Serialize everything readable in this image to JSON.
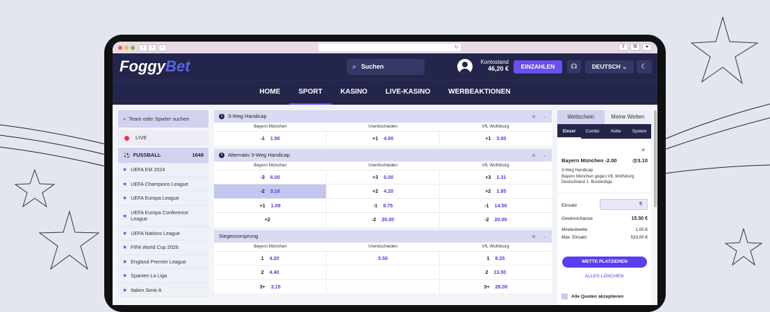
{
  "header": {
    "logo_part1": "Foggy",
    "logo_part2": "Bet",
    "search_label": "Suchen",
    "balance_label": "Kontostand",
    "balance_value": "46,20 €",
    "deposit_button": "EINZAHLEN",
    "language": "DEUTSCH ⌄"
  },
  "nav": {
    "items": [
      "HOME",
      "SPORT",
      "KASINO",
      "LIVE-KASINO",
      "WERBEAKTIONEN"
    ],
    "active": "SPORT"
  },
  "sidebar": {
    "search_placeholder": "Team oder Spieler suchen",
    "live": "LIVE",
    "football": "FUSSBALL",
    "football_count": "1648",
    "leagues": [
      "UEFA EM 2024",
      "UEFA Champions League",
      "UEFA Europa League",
      "UEFA Europa Conference League",
      "UEFA Nations League",
      "FIFA World Cup 2026",
      "England Premier League",
      "Spanien La Liga",
      "Italien Serie A"
    ]
  },
  "markets": {
    "m1": {
      "title": "3-Weg Handicap",
      "cols": [
        "Bayern München",
        "Unentschieden",
        "VfL Wolfsburg"
      ],
      "rows": [
        [
          {
            "h": "-1",
            "o": "1.90"
          },
          {
            "h": "+1",
            "o": "4.00"
          },
          {
            "h": "+1",
            "o": "3.00"
          }
        ]
      ]
    },
    "m2": {
      "title": "Alternativ 3-Weg Handicap",
      "cols": [
        "Bayern München",
        "Unentschieden",
        "VfL Wolfsburg"
      ],
      "rows": [
        [
          {
            "h": "-3",
            "o": "6.00"
          },
          {
            "h": "+3",
            "o": "6.00"
          },
          {
            "h": "+3",
            "o": "1.31"
          }
        ],
        [
          {
            "h": "-2",
            "o": "3.10"
          },
          {
            "h": "+2",
            "o": "4.20"
          },
          {
            "h": "+2",
            "o": "1.85"
          }
        ],
        [
          {
            "h": "+1",
            "o": "1.09"
          },
          {
            "h": "-1",
            "o": "8.75"
          },
          {
            "h": "-1",
            "o": "14.50"
          }
        ],
        [
          {
            "h": "+2",
            "o": ""
          },
          {
            "h": "-2",
            "o": "20.00"
          },
          {
            "h": "-2",
            "o": "20.00"
          }
        ]
      ]
    },
    "m3": {
      "title": "Siegesvorsprung",
      "cols": [
        "Bayern München",
        "Unentschieden",
        "VfL Wolfsburg"
      ],
      "rows": [
        [
          {
            "h": "1",
            "o": "4.20"
          },
          {
            "h": "",
            "o": "5.50"
          },
          {
            "h": "1",
            "o": "8.25"
          }
        ],
        [
          {
            "h": "2",
            "o": "4.40"
          },
          {
            "h": "",
            "o": ""
          },
          {
            "h": "2",
            "o": "13.00"
          }
        ],
        [
          {
            "h": "3+",
            "o": "3.15"
          },
          {
            "h": "",
            "o": ""
          },
          {
            "h": "3+",
            "o": "28.00"
          }
        ]
      ]
    }
  },
  "betslip": {
    "tab_slip": "Wettschein",
    "tab_mybets": "Meine Wetten",
    "types": [
      "Einzel",
      "Combo",
      "Kette",
      "System"
    ],
    "selection": "Bayern München -2.00",
    "selection_odds": "@3.10",
    "market": "3-Weg Handicap",
    "match": "Bayern München gegen VfL Wolfsburg",
    "league": "Deutschland 1. Bundesliga",
    "stake_label": "Einsatz",
    "stake_value": "5",
    "win_label": "Gewinnchance",
    "win_value": "15.50 €",
    "min_label": "Mindestwette:",
    "min_value": "1,00 €",
    "max_label": "Max. Einsatz:",
    "max_value": "533,00 €",
    "place_button": "WETTE PLATZIEREN",
    "clear_all": "ALLES LÖSCHEN",
    "accept_odds": "Alle Quoten akzeptieren"
  }
}
